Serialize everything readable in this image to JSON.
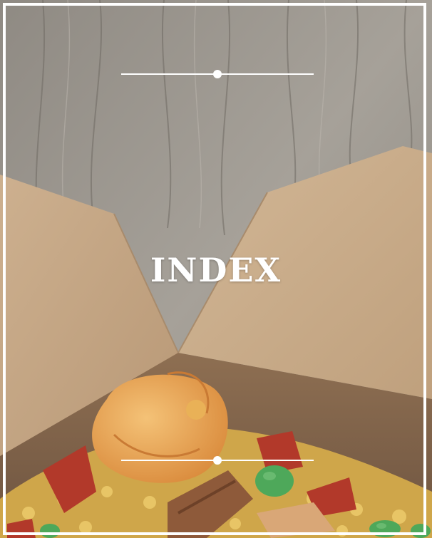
{
  "page": {
    "title": "INDEX"
  },
  "colors": {
    "frame": "#ffffff",
    "wood": "#9a958d",
    "cardboard": "#c9ab88",
    "shrimp": "#e6a24e",
    "rice": "#d9b04a",
    "peas": "#4ea85a",
    "chorizo": "#b2392a"
  }
}
